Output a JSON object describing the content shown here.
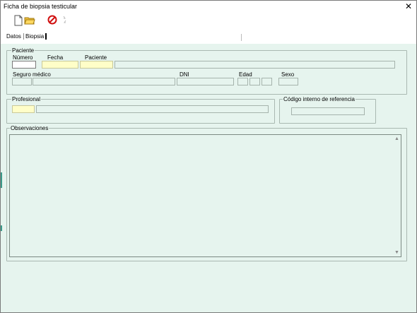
{
  "window": {
    "title": "Ficha de biopsia testicular",
    "close_glyph": "✕"
  },
  "toolbar": {
    "icons": [
      "new-document-icon",
      "open-folder-icon",
      "cancel-icon",
      "disabled-action-icon"
    ]
  },
  "tabs": [
    {
      "label": "Datos"
    },
    {
      "label": "Biopsia"
    }
  ],
  "paciente": {
    "group_label": "Paciente",
    "numero_label": "Número",
    "fecha_label": "Fecha",
    "paciente_label": "Paciente",
    "seguro_label": "Seguro médico",
    "dni_label": "DNI",
    "edad_label": "Edad",
    "sexo_label": "Sexo"
  },
  "profesional": {
    "group_label": "Profesional"
  },
  "codigo": {
    "group_label": "Código interno de referencia"
  },
  "observaciones": {
    "group_label": "Observaciones"
  },
  "colors": {
    "background": "#e6f4ee",
    "required_field": "#fffec8"
  }
}
